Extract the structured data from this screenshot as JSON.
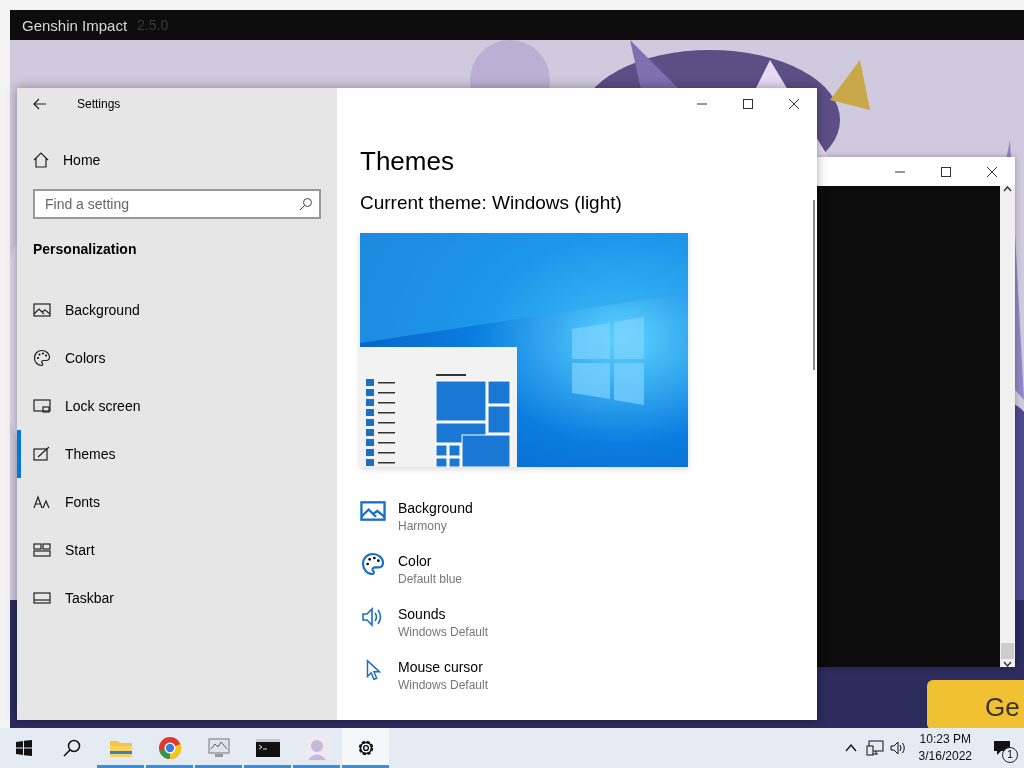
{
  "launcher": {
    "title": "Genshin Impact",
    "version": "2.5.0",
    "button": "Ge"
  },
  "settings": {
    "title": "Settings",
    "home": "Home",
    "search": {
      "placeholder": "Find a setting"
    },
    "section": "Personalization",
    "nav": [
      {
        "label": "Background",
        "selected": false
      },
      {
        "label": "Colors",
        "selected": false
      },
      {
        "label": "Lock screen",
        "selected": false
      },
      {
        "label": "Themes",
        "selected": true
      },
      {
        "label": "Fonts",
        "selected": false
      },
      {
        "label": "Start",
        "selected": false
      },
      {
        "label": "Taskbar",
        "selected": false
      }
    ],
    "page_title": "Themes",
    "current_theme": "Current theme: Windows (light)",
    "theme_items": [
      {
        "label": "Background",
        "value": "Harmony"
      },
      {
        "label": "Color",
        "value": "Default blue"
      },
      {
        "label": "Sounds",
        "value": "Windows Default"
      },
      {
        "label": "Mouse cursor",
        "value": "Windows Default"
      }
    ]
  },
  "taskbar": {
    "apps": [
      {
        "running": true,
        "selected": false
      },
      {
        "running": true,
        "selected": false
      },
      {
        "running": true,
        "selected": false
      },
      {
        "running": true,
        "selected": false
      },
      {
        "running": true,
        "selected": false
      },
      {
        "running": true,
        "selected": true
      }
    ],
    "time": "10:23 PM",
    "date": "3/16/2022",
    "notifications": "1"
  }
}
